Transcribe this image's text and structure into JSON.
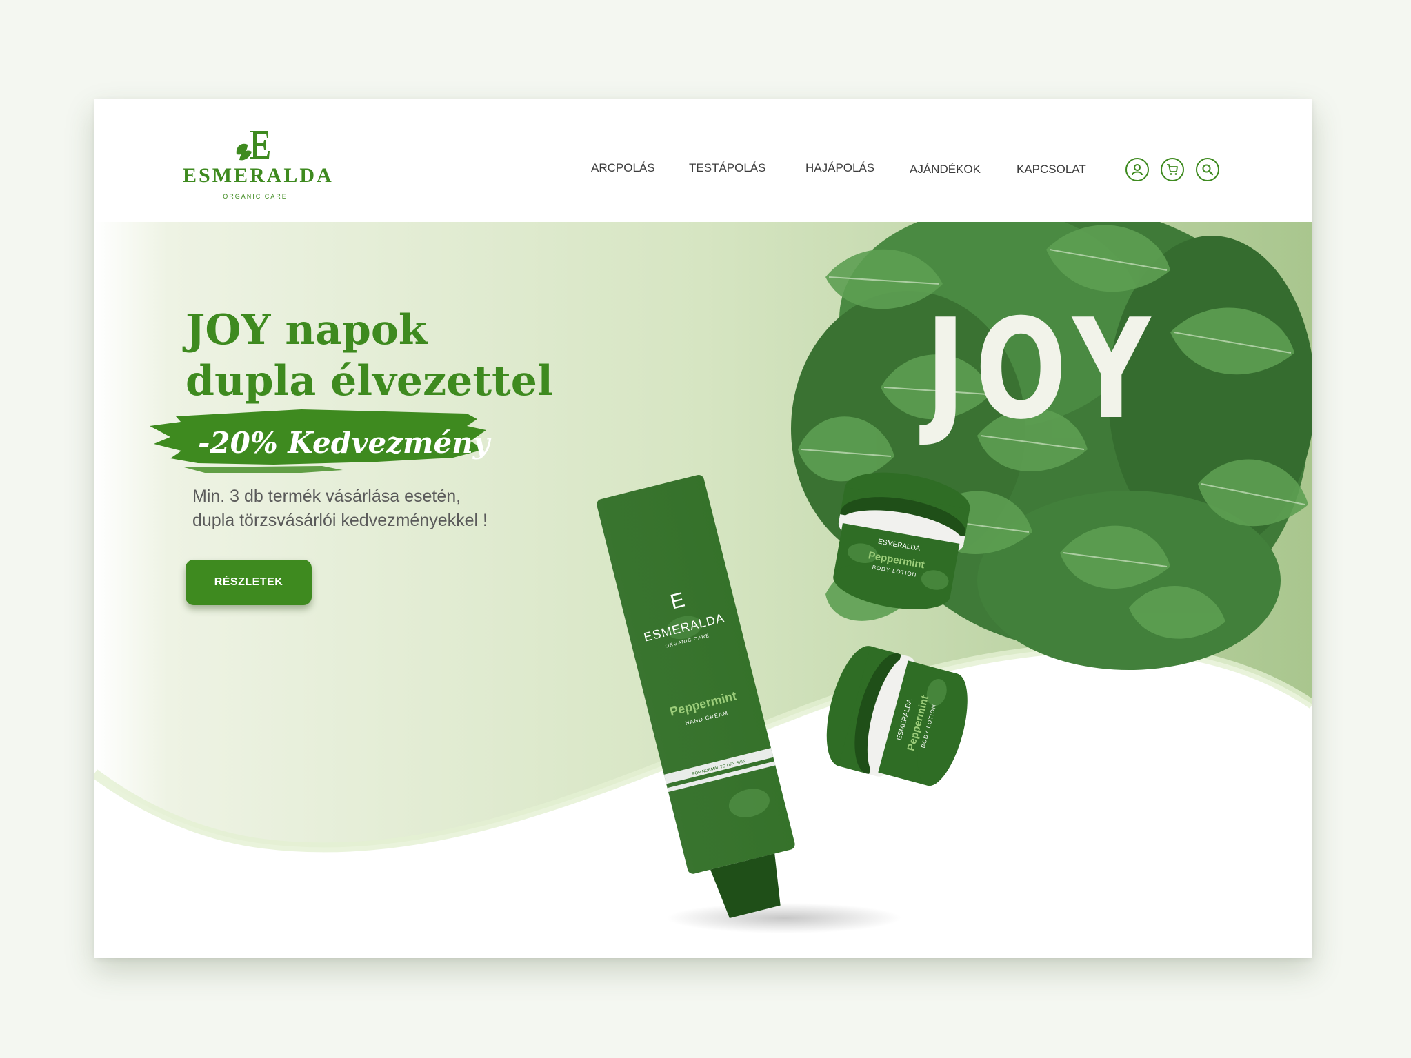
{
  "brand": {
    "name": "ESMERALDA",
    "tagline": "ORGANIC CARE",
    "color": "#3e8a1f"
  },
  "nav": {
    "items": [
      {
        "label": "ARCPOLÁS"
      },
      {
        "label": "TESTÁPOLÁS"
      },
      {
        "label": "HAJÁPOLÁS"
      },
      {
        "label": "AJÁNDÉKOK"
      },
      {
        "label": "KAPCSOLAT"
      }
    ],
    "icons": [
      "user-icon",
      "cart-icon",
      "search-icon"
    ]
  },
  "hero": {
    "title": "JOY napok\ndupla élvezettel",
    "discount": "-20% Kedvezmény",
    "subtext": "Min. 3 db termék vásárlása esetén,\ndupla törzsvásárlói kedvezményekkel !",
    "cta_label": "RÉSZLETEK",
    "background_word": "JOY"
  },
  "products": {
    "tube": {
      "brand": "ESMERALDA",
      "tagline": "ORGANIC CARE",
      "name": "Peppermint",
      "type": "HAND CREAM",
      "note": "FOR NORMAL TO DRY SKIN"
    },
    "jar_top": {
      "brand": "ESMERALDA",
      "name": "Peppermint",
      "type": "BODY LOTION"
    },
    "jar_bottom": {
      "brand": "ESMERALDA",
      "name": "Peppermint",
      "type": "BODY LOTION"
    }
  }
}
